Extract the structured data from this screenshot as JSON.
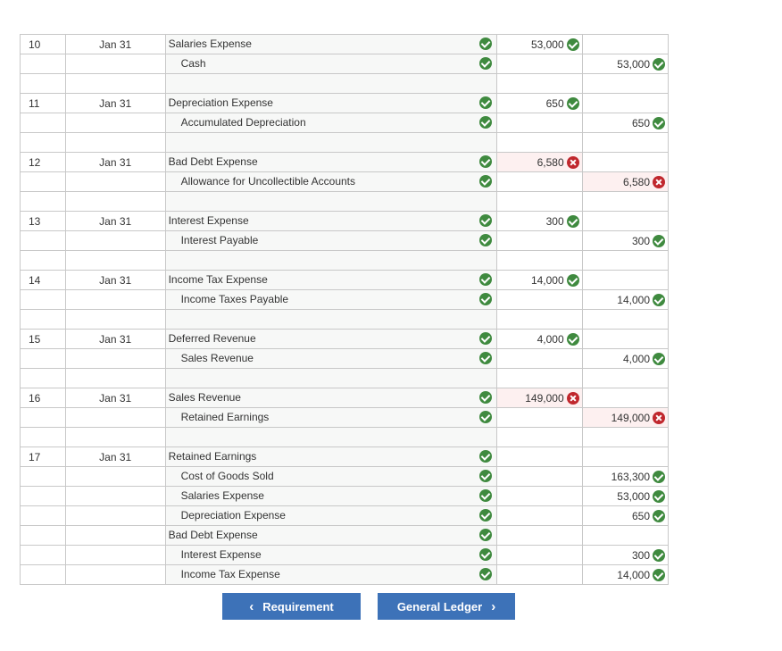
{
  "entries": [
    {
      "no": "10",
      "date": "Jan 31",
      "lines": [
        {
          "account": "Salaries Expense",
          "indent": false,
          "debit": "53,000",
          "debit_status": "ok",
          "credit": "",
          "credit_status": ""
        },
        {
          "account": "Cash",
          "indent": true,
          "debit": "",
          "debit_status": "",
          "credit": "53,000",
          "credit_status": "ok"
        }
      ]
    },
    {
      "no": "11",
      "date": "Jan 31",
      "lines": [
        {
          "account": "Depreciation Expense",
          "indent": false,
          "debit": "650",
          "debit_status": "ok",
          "credit": "",
          "credit_status": ""
        },
        {
          "account": "Accumulated Depreciation",
          "indent": true,
          "debit": "",
          "debit_status": "",
          "credit": "650",
          "credit_status": "ok"
        }
      ]
    },
    {
      "no": "12",
      "date": "Jan 31",
      "lines": [
        {
          "account": "Bad Debt Expense",
          "indent": false,
          "debit": "6,580",
          "debit_status": "bad",
          "credit": "",
          "credit_status": ""
        },
        {
          "account": "Allowance for Uncollectible Accounts",
          "indent": true,
          "debit": "",
          "debit_status": "",
          "credit": "6,580",
          "credit_status": "bad"
        }
      ]
    },
    {
      "no": "13",
      "date": "Jan 31",
      "lines": [
        {
          "account": "Interest Expense",
          "indent": false,
          "debit": "300",
          "debit_status": "ok",
          "credit": "",
          "credit_status": ""
        },
        {
          "account": "Interest Payable",
          "indent": true,
          "debit": "",
          "debit_status": "",
          "credit": "300",
          "credit_status": "ok"
        }
      ]
    },
    {
      "no": "14",
      "date": "Jan 31",
      "lines": [
        {
          "account": "Income Tax Expense",
          "indent": false,
          "debit": "14,000",
          "debit_status": "ok",
          "credit": "",
          "credit_status": ""
        },
        {
          "account": "Income Taxes Payable",
          "indent": true,
          "debit": "",
          "debit_status": "",
          "credit": "14,000",
          "credit_status": "ok"
        }
      ]
    },
    {
      "no": "15",
      "date": "Jan 31",
      "lines": [
        {
          "account": "Deferred Revenue",
          "indent": false,
          "debit": "4,000",
          "debit_status": "ok",
          "credit": "",
          "credit_status": ""
        },
        {
          "account": "Sales Revenue",
          "indent": true,
          "debit": "",
          "debit_status": "",
          "credit": "4,000",
          "credit_status": "ok"
        }
      ]
    },
    {
      "no": "16",
      "date": "Jan 31",
      "lines": [
        {
          "account": "Sales Revenue",
          "indent": false,
          "debit": "149,000",
          "debit_status": "bad",
          "credit": "",
          "credit_status": ""
        },
        {
          "account": "Retained Earnings",
          "indent": true,
          "debit": "",
          "debit_status": "",
          "credit": "149,000",
          "credit_status": "bad"
        }
      ]
    },
    {
      "no": "17",
      "date": "Jan 31",
      "lines": [
        {
          "account": "Retained Earnings",
          "indent": false,
          "debit": "",
          "debit_status": "",
          "credit": "",
          "credit_status": ""
        },
        {
          "account": "Cost of Goods Sold",
          "indent": true,
          "debit": "",
          "debit_status": "",
          "credit": "163,300",
          "credit_status": "ok"
        },
        {
          "account": "Salaries Expense",
          "indent": true,
          "debit": "",
          "debit_status": "",
          "credit": "53,000",
          "credit_status": "ok"
        },
        {
          "account": "Depreciation Expense",
          "indent": true,
          "debit": "",
          "debit_status": "",
          "credit": "650",
          "credit_status": "ok"
        },
        {
          "account": "Bad Debt Expense",
          "indent": false,
          "debit": "",
          "debit_status": "",
          "credit": "",
          "credit_status": ""
        },
        {
          "account": "Interest Expense",
          "indent": true,
          "debit": "",
          "debit_status": "",
          "credit": "300",
          "credit_status": "ok"
        },
        {
          "account": "Income Tax Expense",
          "indent": true,
          "debit": "",
          "debit_status": "",
          "credit": "14,000",
          "credit_status": "ok"
        }
      ]
    }
  ],
  "nav": {
    "prev_label": "Requirement",
    "next_label": "General Ledger"
  },
  "colors": {
    "ok": "#3f8a3f",
    "bad": "#c0272d",
    "button": "#3d72b8"
  }
}
